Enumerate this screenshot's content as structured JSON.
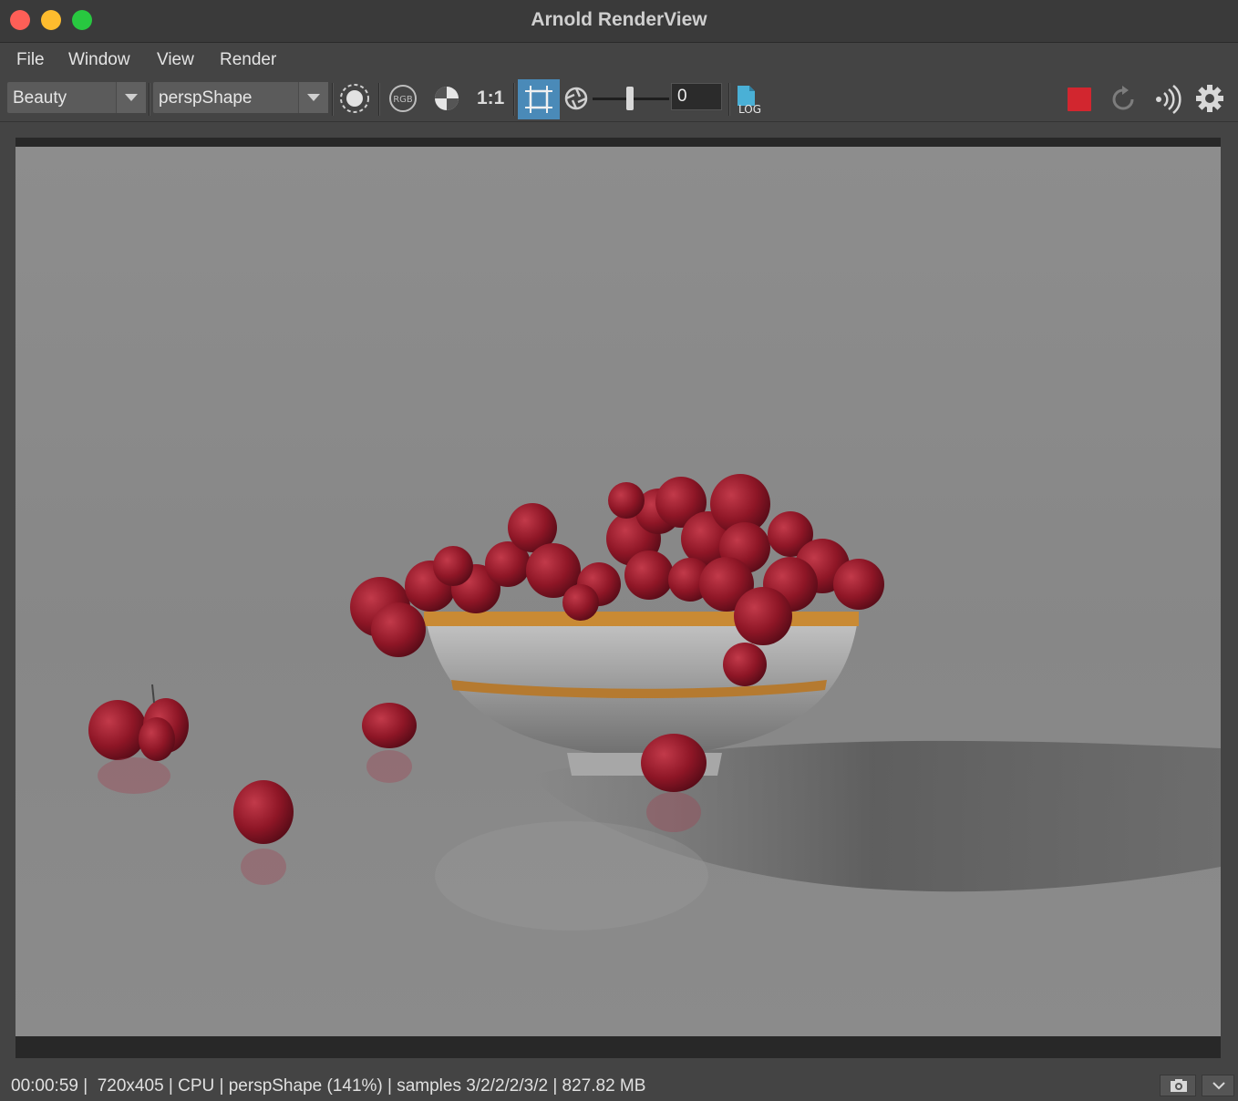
{
  "window": {
    "title": "Arnold RenderView"
  },
  "menu": {
    "items": [
      "File",
      "Window",
      "View",
      "Render"
    ]
  },
  "toolbar": {
    "aov": "Beauty",
    "camera": "perspShape",
    "ratio_label": "1:1",
    "exposure_value": "0",
    "icons": [
      "render-region-icon",
      "rgb-channels-icon",
      "ab-compare-icon",
      "crop-region-icon",
      "shutter-icon",
      "log-icon",
      "stop-render-icon",
      "refresh-icon",
      "broadcast-icon",
      "settings-icon"
    ],
    "colors": {
      "crop_active": "#4a8ab8",
      "stop": "#d2262f",
      "log": "#4ab0d6"
    }
  },
  "status": {
    "text": "00:00:59 |  720x405 | CPU | perspShape (141%) | samples 3/2/2/2/3/2 | 827.82 MB"
  },
  "render_image": {
    "subject": "red grapes in striped bowl on gray surface"
  }
}
